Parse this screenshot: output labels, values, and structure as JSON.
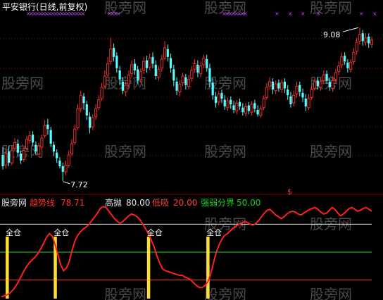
{
  "colors": {
    "background": "#000000",
    "up_candle": "#ff3232",
    "down_candle": "#54ffff",
    "grid": "#8b0000",
    "trend_line": "#ff2020",
    "high_line": "#e8e8e8",
    "low_line": "#ff4040",
    "divide_line": "#20d020",
    "full_bar": "#ffdd33",
    "marker": "#cc44ff",
    "watermark": "#4a4a4a"
  },
  "watermarks": [
    "股旁网",
    "股旁网",
    "股旁网",
    "股旁网",
    "股旁网",
    "股旁网",
    "股旁网",
    "股旁网",
    "股旁网",
    "股旁网",
    "股旁网",
    "股旁网"
  ],
  "chart_data": [
    {
      "type": "candlestick",
      "title": "平安银行(日线,前复权)",
      "annotations": [
        {
          "text": "9.08",
          "type": "high"
        },
        {
          "text": "7.72",
          "type": "low"
        }
      ],
      "ylim": [
        7.6,
        9.2
      ],
      "candles": [
        [
          7.95,
          7.85,
          8.02,
          7.82
        ],
        [
          7.86,
          7.96,
          8.0,
          7.83
        ],
        [
          7.98,
          7.88,
          8.03,
          7.85
        ],
        [
          7.88,
          7.99,
          8.03,
          7.86
        ],
        [
          8.01,
          8.06,
          8.1,
          7.98
        ],
        [
          8.05,
          7.97,
          8.09,
          7.94
        ],
        [
          7.96,
          7.9,
          7.99,
          7.87
        ],
        [
          7.91,
          7.99,
          8.02,
          7.89
        ],
        [
          8.01,
          8.09,
          8.12,
          7.99
        ],
        [
          8.08,
          8.12,
          8.16,
          8.05
        ],
        [
          8.13,
          8.06,
          8.16,
          8.03
        ],
        [
          8.04,
          7.98,
          8.07,
          7.95
        ],
        [
          7.96,
          8.03,
          8.06,
          7.93
        ],
        [
          8.02,
          8.1,
          8.13,
          8.0
        ],
        [
          8.12,
          8.21,
          8.26,
          8.1
        ],
        [
          8.22,
          8.18,
          8.27,
          8.13
        ],
        [
          8.17,
          8.05,
          8.2,
          8.02
        ],
        [
          8.04,
          7.98,
          8.07,
          7.94
        ],
        [
          7.97,
          7.92,
          8.0,
          7.88
        ],
        [
          7.9,
          7.85,
          7.93,
          7.83
        ],
        [
          7.85,
          7.8,
          7.88,
          7.72
        ],
        [
          7.8,
          7.86,
          7.9,
          7.77
        ],
        [
          7.86,
          7.95,
          7.99,
          7.84
        ],
        [
          7.96,
          8.05,
          8.09,
          7.94
        ],
        [
          8.06,
          8.18,
          8.22,
          8.04
        ],
        [
          8.19,
          8.36,
          8.4,
          8.17
        ],
        [
          8.36,
          8.48,
          8.52,
          8.33
        ],
        [
          8.47,
          8.41,
          8.5,
          8.35
        ],
        [
          8.4,
          8.3,
          8.43,
          8.26
        ],
        [
          8.29,
          8.19,
          8.33,
          8.14
        ],
        [
          8.2,
          8.28,
          8.31,
          8.17
        ],
        [
          8.29,
          8.36,
          8.4,
          8.26
        ],
        [
          8.37,
          8.44,
          8.48,
          8.35
        ],
        [
          8.45,
          8.55,
          8.59,
          8.43
        ],
        [
          8.56,
          8.65,
          8.7,
          8.54
        ],
        [
          8.66,
          8.76,
          8.82,
          8.64
        ],
        [
          8.78,
          8.89,
          8.99,
          8.75
        ],
        [
          8.9,
          8.82,
          8.94,
          8.78
        ],
        [
          8.83,
          8.72,
          8.86,
          8.68
        ],
        [
          8.7,
          8.62,
          8.74,
          8.57
        ],
        [
          8.6,
          8.52,
          8.64,
          8.49
        ],
        [
          8.51,
          8.57,
          8.6,
          8.47
        ],
        [
          8.58,
          8.66,
          8.7,
          8.55
        ],
        [
          8.67,
          8.75,
          8.79,
          8.64
        ],
        [
          8.76,
          8.7,
          8.8,
          8.66
        ],
        [
          8.71,
          8.61,
          8.74,
          8.58
        ],
        [
          8.62,
          8.69,
          8.72,
          8.59
        ],
        [
          8.7,
          8.78,
          8.82,
          8.67
        ],
        [
          8.79,
          8.72,
          8.83,
          8.68
        ],
        [
          8.73,
          8.81,
          8.85,
          8.7
        ],
        [
          8.82,
          8.76,
          8.86,
          8.72
        ],
        [
          8.75,
          8.65,
          8.79,
          8.62
        ],
        [
          8.64,
          8.71,
          8.74,
          8.61
        ],
        [
          8.72,
          8.8,
          8.84,
          8.69
        ],
        [
          8.81,
          8.9,
          8.96,
          8.79
        ],
        [
          8.89,
          8.82,
          8.93,
          8.78
        ],
        [
          8.81,
          8.72,
          8.85,
          8.68
        ],
        [
          8.71,
          8.61,
          8.75,
          8.56
        ],
        [
          8.6,
          8.52,
          8.64,
          8.48
        ],
        [
          8.51,
          8.58,
          8.61,
          8.47
        ],
        [
          8.59,
          8.65,
          8.68,
          8.56
        ],
        [
          8.64,
          8.57,
          8.67,
          8.53
        ],
        [
          8.56,
          8.62,
          8.66,
          8.53
        ],
        [
          8.63,
          8.7,
          8.74,
          8.6
        ],
        [
          8.71,
          8.76,
          8.8,
          8.68
        ],
        [
          8.75,
          8.68,
          8.79,
          8.64
        ],
        [
          8.67,
          8.74,
          8.78,
          8.64
        ],
        [
          8.75,
          8.81,
          8.84,
          8.72
        ],
        [
          8.8,
          8.72,
          8.84,
          8.69
        ],
        [
          8.72,
          8.6,
          8.76,
          8.55
        ],
        [
          8.59,
          8.48,
          8.63,
          8.44
        ],
        [
          8.47,
          8.41,
          8.51,
          8.37
        ],
        [
          8.42,
          8.49,
          8.52,
          8.39
        ],
        [
          8.5,
          8.45,
          8.53,
          8.41
        ],
        [
          8.44,
          8.38,
          8.48,
          8.35
        ],
        [
          8.37,
          8.43,
          8.46,
          8.34
        ],
        [
          8.44,
          8.4,
          8.47,
          8.36
        ],
        [
          8.39,
          8.35,
          8.43,
          8.32
        ],
        [
          8.34,
          8.41,
          8.44,
          8.31
        ],
        [
          8.42,
          8.38,
          8.45,
          8.35
        ],
        [
          8.37,
          8.33,
          8.41,
          8.3
        ],
        [
          8.32,
          8.38,
          8.41,
          8.29
        ],
        [
          8.39,
          8.34,
          8.42,
          8.31
        ],
        [
          8.33,
          8.4,
          8.43,
          8.3
        ],
        [
          8.41,
          8.36,
          8.44,
          8.33
        ],
        [
          8.35,
          8.31,
          8.39,
          8.29
        ],
        [
          8.3,
          8.36,
          8.39,
          8.28
        ],
        [
          8.37,
          8.45,
          8.48,
          8.35
        ],
        [
          8.46,
          8.55,
          8.59,
          8.44
        ],
        [
          8.56,
          8.6,
          8.64,
          8.53
        ],
        [
          8.6,
          8.53,
          8.63,
          8.49
        ],
        [
          8.52,
          8.58,
          8.61,
          8.49
        ],
        [
          8.59,
          8.54,
          8.62,
          8.51
        ],
        [
          8.53,
          8.59,
          8.62,
          8.5
        ],
        [
          8.6,
          8.54,
          8.63,
          8.5
        ],
        [
          8.53,
          8.48,
          8.57,
          8.44
        ],
        [
          8.47,
          8.4,
          8.51,
          8.37
        ],
        [
          8.41,
          8.48,
          8.52,
          8.38
        ],
        [
          8.49,
          8.56,
          8.6,
          8.46
        ],
        [
          8.57,
          8.51,
          8.6,
          8.47
        ],
        [
          8.5,
          8.46,
          8.54,
          8.42
        ],
        [
          8.45,
          8.38,
          8.49,
          8.34
        ],
        [
          8.37,
          8.45,
          8.49,
          8.35
        ],
        [
          8.46,
          8.53,
          8.57,
          8.44
        ],
        [
          8.54,
          8.6,
          8.63,
          8.52
        ],
        [
          8.61,
          8.56,
          8.64,
          8.53
        ],
        [
          8.55,
          8.6,
          8.63,
          8.52
        ],
        [
          8.61,
          8.66,
          8.7,
          8.58
        ],
        [
          8.67,
          8.61,
          8.7,
          8.58
        ],
        [
          8.6,
          8.55,
          8.63,
          8.52
        ],
        [
          8.54,
          8.61,
          8.65,
          8.51
        ],
        [
          8.62,
          8.68,
          8.71,
          8.59
        ],
        [
          8.69,
          8.74,
          8.78,
          8.66
        ],
        [
          8.75,
          8.82,
          8.86,
          8.72
        ],
        [
          8.83,
          8.78,
          8.86,
          8.75
        ],
        [
          8.77,
          8.72,
          8.8,
          8.68
        ],
        [
          8.71,
          8.77,
          8.8,
          8.68
        ],
        [
          8.78,
          8.86,
          8.9,
          8.75
        ],
        [
          8.87,
          8.95,
          8.99,
          8.84
        ],
        [
          8.96,
          9.02,
          9.08,
          8.93
        ],
        [
          9.03,
          8.96,
          9.06,
          8.92
        ],
        [
          8.95,
          8.99,
          9.03,
          8.92
        ],
        [
          9.0,
          8.94,
          9.03,
          8.9
        ],
        [
          8.93,
          8.97,
          9.0,
          8.9
        ]
      ]
    },
    {
      "type": "line",
      "title": "股旁网",
      "series": [
        {
          "name": "趋势线",
          "value": "78.71",
          "values": [
            2,
            3,
            4,
            6,
            9,
            13,
            18,
            24,
            30,
            35,
            39,
            42,
            45,
            49,
            54,
            60,
            66,
            70,
            67,
            58,
            47,
            36,
            30,
            33,
            40,
            52,
            62,
            68,
            72,
            75,
            77,
            80,
            84,
            88,
            92,
            97,
            99,
            98,
            94,
            90,
            86,
            83,
            81,
            83,
            86,
            89,
            91,
            90,
            88,
            85,
            80,
            75,
            70,
            63,
            56,
            46,
            38,
            32,
            30,
            29,
            28,
            27,
            26,
            25,
            25,
            23,
            22,
            20,
            17,
            14,
            12,
            12,
            14,
            18,
            26,
            38,
            50,
            58,
            64,
            68,
            70,
            73,
            76,
            78,
            80,
            81,
            83,
            82,
            80,
            79,
            81,
            84,
            88,
            92,
            95,
            96,
            93,
            90,
            88,
            86,
            88,
            91,
            93,
            94,
            93,
            91,
            90,
            92,
            94,
            96,
            97,
            98,
            96,
            93,
            91,
            92,
            95,
            98,
            96,
            92,
            89,
            91,
            94,
            97,
            98,
            96,
            94,
            95,
            97,
            98,
            96,
            94
          ]
        }
      ],
      "levels": [
        {
          "name": "高抛",
          "value": "80.00",
          "y": 80
        },
        {
          "name": "低吸",
          "value": "20.00",
          "y": 20
        },
        {
          "name": "强弱分界",
          "value": "50.00",
          "y": 50
        }
      ],
      "signals": [
        {
          "label": "全仓",
          "index": 2
        },
        {
          "label": "全仓",
          "index": 19
        },
        {
          "label": "全仓",
          "index": 52
        },
        {
          "label": "全仓",
          "index": 73
        }
      ],
      "ylim": [
        0,
        100
      ]
    }
  ]
}
